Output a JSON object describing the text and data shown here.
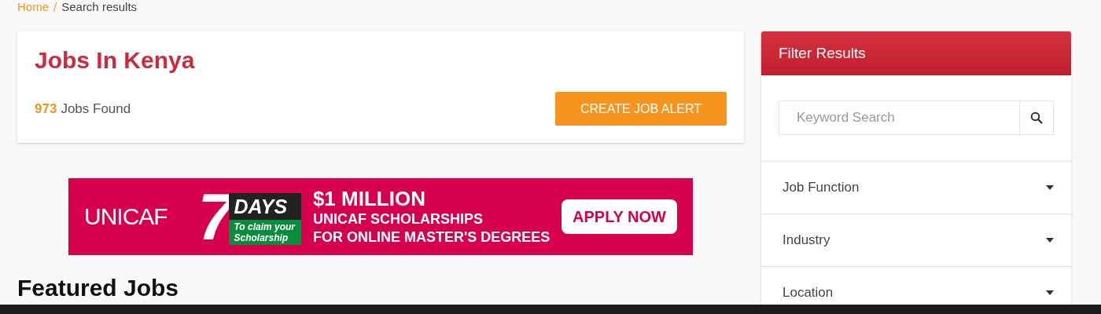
{
  "breadcrumb": [
    {
      "label": "Home",
      "kind": "link"
    },
    {
      "label": "/",
      "kind": "separator"
    },
    {
      "label": "Search results",
      "kind": "current"
    }
  ],
  "results": {
    "title": "Jobs In Kenya",
    "count": "973",
    "count_label": "Jobs Found",
    "button": "CREATE JOB ALERT"
  },
  "banner": {
    "logo": "UNICAF",
    "days_number": "7",
    "days_label": "DAYS",
    "days_note": "To claim your Scholarship",
    "headline": "$1 MILLION",
    "line_1": "UNICAF SCHOLARSHIPS",
    "line_2": "FOR ONLINE MASTER'S DEGREES",
    "button": "APPLY NOW"
  },
  "featured_heading": "Featured Jobs",
  "filter": {
    "title": "Filter Results",
    "search": {
      "placeholder": "Keyword Search"
    },
    "sections": [
      {
        "label": "Job Function",
        "expanded": false
      },
      {
        "label": "Industry",
        "expanded": false
      },
      {
        "label": "Location",
        "expanded": false
      }
    ]
  }
}
